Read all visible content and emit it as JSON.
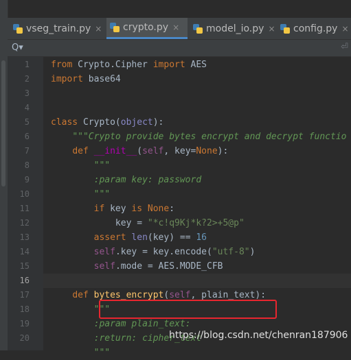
{
  "tabs": [
    {
      "label": "vseg_train.py",
      "close": "×"
    },
    {
      "label": "crypto.py",
      "close": "×"
    },
    {
      "label": "model_io.py",
      "close": "×"
    },
    {
      "label": "config.py",
      "close": "×"
    }
  ],
  "search": {
    "icon": "Q▾",
    "wrap_icon": "⏎"
  },
  "line_numbers": [
    "1",
    "2",
    "3",
    "4",
    "5",
    "6",
    "7",
    "8",
    "9",
    "10",
    "11",
    "12",
    "13",
    "14",
    "15",
    "16",
    "17",
    "18",
    "19",
    "20"
  ],
  "code": [
    [
      {
        "t": "from ",
        "c": "kw"
      },
      {
        "t": "Crypto.Cipher ",
        "c": ""
      },
      {
        "t": "import ",
        "c": "kw"
      },
      {
        "t": "AES",
        "c": ""
      }
    ],
    [
      {
        "t": "import ",
        "c": "kw"
      },
      {
        "t": "base64",
        "c": ""
      }
    ],
    [],
    [],
    [
      {
        "t": "class ",
        "c": "kw"
      },
      {
        "t": "Crypto(",
        "c": ""
      },
      {
        "t": "object",
        "c": "bi"
      },
      {
        "t": "):",
        "c": ""
      }
    ],
    [
      {
        "t": "    ",
        "c": ""
      },
      {
        "t": "\"\"\"Crypto provide bytes encrypt and decrypt functio",
        "c": "doc"
      }
    ],
    [
      {
        "t": "    ",
        "c": ""
      },
      {
        "t": "def ",
        "c": "kw"
      },
      {
        "t": "__init__",
        "c": "magic"
      },
      {
        "t": "(",
        "c": ""
      },
      {
        "t": "self",
        "c": "self"
      },
      {
        "t": ", key=",
        "c": ""
      },
      {
        "t": "None",
        "c": "kw"
      },
      {
        "t": "):",
        "c": ""
      }
    ],
    [
      {
        "t": "        ",
        "c": ""
      },
      {
        "t": "\"\"\"",
        "c": "doc"
      }
    ],
    [
      {
        "t": "        ",
        "c": ""
      },
      {
        "t": ":param key: password",
        "c": "doc"
      }
    ],
    [
      {
        "t": "        ",
        "c": ""
      },
      {
        "t": "\"\"\"",
        "c": "doc"
      }
    ],
    [
      {
        "t": "        ",
        "c": ""
      },
      {
        "t": "if ",
        "c": "kw"
      },
      {
        "t": "key ",
        "c": ""
      },
      {
        "t": "is ",
        "c": "kw"
      },
      {
        "t": "None",
        "c": "kw"
      },
      {
        "t": ":",
        "c": ""
      }
    ],
    [
      {
        "t": "            ",
        "c": ""
      },
      {
        "t": "key = ",
        "c": ""
      },
      {
        "t": "\"*c!q9Kj*k?2>+5@p\"",
        "c": "str"
      }
    ],
    [
      {
        "t": "        ",
        "c": ""
      },
      {
        "t": "assert ",
        "c": "kw"
      },
      {
        "t": "len",
        "c": "bi"
      },
      {
        "t": "(key) == ",
        "c": ""
      },
      {
        "t": "16",
        "c": "num"
      }
    ],
    [
      {
        "t": "        ",
        "c": ""
      },
      {
        "t": "self",
        "c": "self"
      },
      {
        "t": ".key = key.encode(",
        "c": ""
      },
      {
        "t": "\"utf-8\"",
        "c": "str"
      },
      {
        "t": ")",
        "c": ""
      }
    ],
    [
      {
        "t": "        ",
        "c": ""
      },
      {
        "t": "self",
        "c": "self"
      },
      {
        "t": ".mode = AES.MODE_CFB",
        "c": ""
      }
    ],
    [],
    [
      {
        "t": "    ",
        "c": ""
      },
      {
        "t": "def ",
        "c": "kw"
      },
      {
        "t": "bytes_encrypt",
        "c": "fn"
      },
      {
        "t": "(",
        "c": ""
      },
      {
        "t": "self",
        "c": "self"
      },
      {
        "t": ", plain_text):",
        "c": ""
      }
    ],
    [
      {
        "t": "        ",
        "c": ""
      },
      {
        "t": "\"\"\"",
        "c": "doc"
      }
    ],
    [
      {
        "t": "        ",
        "c": ""
      },
      {
        "t": ":param plain_text:",
        "c": "doc"
      }
    ],
    [
      {
        "t": "        ",
        "c": ""
      },
      {
        "t": ":return: cipher_text",
        "c": "doc"
      }
    ],
    [
      {
        "t": "        ",
        "c": ""
      },
      {
        "t": "\"\"\"",
        "c": "doc"
      }
    ]
  ],
  "current_line_index": 15,
  "watermark": "https://blog.csdn.net/chenran187906"
}
